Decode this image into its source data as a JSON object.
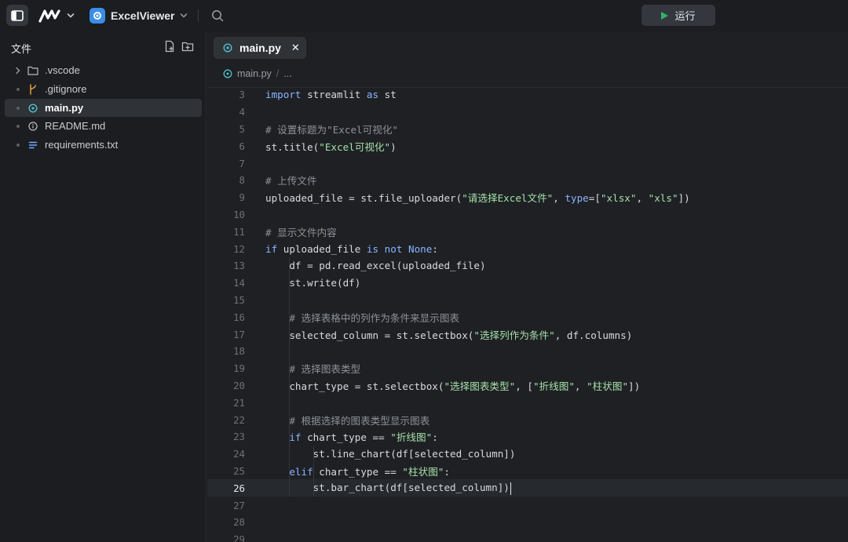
{
  "topbar": {
    "project_name": "ExcelViewer",
    "run_label": "运行"
  },
  "sidebar": {
    "title": "文件",
    "items": [
      {
        "label": ".vscode",
        "icon": "folder-icon",
        "type": "folder"
      },
      {
        "label": ".gitignore",
        "icon": "git-branch-icon",
        "type": "file"
      },
      {
        "label": "main.py",
        "icon": "python-file-icon",
        "type": "file",
        "active": true
      },
      {
        "label": "README.md",
        "icon": "info-file-icon",
        "type": "file"
      },
      {
        "label": "requirements.txt",
        "icon": "text-file-icon",
        "type": "file"
      }
    ]
  },
  "editor": {
    "tab_label": "main.py",
    "breadcrumb": [
      "main.py",
      "/",
      "..."
    ],
    "current_line": 26,
    "lines": [
      {
        "n": "3",
        "tokens": [
          [
            "kw",
            "import"
          ],
          [
            "op",
            " streamlit "
          ],
          [
            "kw",
            "as"
          ],
          [
            "op",
            " st"
          ]
        ]
      },
      {
        "n": "4",
        "tokens": []
      },
      {
        "n": "5",
        "tokens": [
          [
            "cm",
            "# 设置标题为\"Excel可视化\""
          ]
        ]
      },
      {
        "n": "6",
        "tokens": [
          [
            "op",
            "st.title("
          ],
          [
            "str",
            "\"Excel可视化\""
          ],
          [
            "op",
            ")"
          ]
        ]
      },
      {
        "n": "7",
        "tokens": []
      },
      {
        "n": "8",
        "tokens": [
          [
            "cm",
            "# 上传文件"
          ]
        ]
      },
      {
        "n": "9",
        "tokens": [
          [
            "op",
            "uploaded_file = st.file_uploader("
          ],
          [
            "str",
            "\"请选择Excel文件\""
          ],
          [
            "op",
            ", "
          ],
          [
            "kw",
            "type"
          ],
          [
            "op",
            "=["
          ],
          [
            "str",
            "\"xlsx\""
          ],
          [
            "op",
            ", "
          ],
          [
            "str",
            "\"xls\""
          ],
          [
            "op",
            "])"
          ]
        ]
      },
      {
        "n": "10",
        "tokens": []
      },
      {
        "n": "11",
        "tokens": [
          [
            "cm",
            "# 显示文件内容"
          ]
        ]
      },
      {
        "n": "12",
        "tokens": [
          [
            "kw",
            "if"
          ],
          [
            "op",
            " uploaded_file "
          ],
          [
            "kw",
            "is not"
          ],
          [
            "op",
            " "
          ],
          [
            "kw",
            "None"
          ],
          [
            "op",
            ":"
          ]
        ]
      },
      {
        "n": "13",
        "tokens": [
          [
            "op",
            "    df = pd.read_excel(uploaded_file)"
          ]
        ]
      },
      {
        "n": "14",
        "tokens": [
          [
            "op",
            "    st.write(df)"
          ]
        ]
      },
      {
        "n": "15",
        "tokens": []
      },
      {
        "n": "16",
        "tokens": [
          [
            "op",
            "    "
          ],
          [
            "cm",
            "# 选择表格中的列作为条件来显示图表"
          ]
        ]
      },
      {
        "n": "17",
        "tokens": [
          [
            "op",
            "    selected_column = st.selectbox("
          ],
          [
            "str",
            "\"选择列作为条件\""
          ],
          [
            "op",
            ", df.columns)"
          ]
        ]
      },
      {
        "n": "18",
        "tokens": []
      },
      {
        "n": "19",
        "tokens": [
          [
            "op",
            "    "
          ],
          [
            "cm",
            "# 选择图表类型"
          ]
        ]
      },
      {
        "n": "20",
        "tokens": [
          [
            "op",
            "    chart_type = st.selectbox("
          ],
          [
            "str",
            "\"选择图表类型\""
          ],
          [
            "op",
            ", ["
          ],
          [
            "str",
            "\"折线图\""
          ],
          [
            "op",
            ", "
          ],
          [
            "str",
            "\"柱状图\""
          ],
          [
            "op",
            "])"
          ]
        ]
      },
      {
        "n": "21",
        "tokens": []
      },
      {
        "n": "22",
        "tokens": [
          [
            "op",
            "    "
          ],
          [
            "cm",
            "# 根据选择的图表类型显示图表"
          ]
        ]
      },
      {
        "n": "23",
        "tokens": [
          [
            "op",
            "    "
          ],
          [
            "kw",
            "if"
          ],
          [
            "op",
            " chart_type == "
          ],
          [
            "str",
            "\"折线图\""
          ],
          [
            "op",
            ":"
          ]
        ]
      },
      {
        "n": "24",
        "tokens": [
          [
            "op",
            "        st.line_chart(df[selected_column])"
          ]
        ]
      },
      {
        "n": "25",
        "tokens": [
          [
            "op",
            "    "
          ],
          [
            "kw",
            "elif"
          ],
          [
            "op",
            " chart_type == "
          ],
          [
            "str",
            "\"柱状图\""
          ],
          [
            "op",
            ":"
          ]
        ]
      },
      {
        "n": "26",
        "tokens": [
          [
            "op",
            "        st.bar_chart(df[selected_column])"
          ]
        ]
      },
      {
        "n": "27",
        "tokens": []
      },
      {
        "n": "28",
        "tokens": []
      },
      {
        "n": "29",
        "tokens": []
      }
    ]
  },
  "colors": {
    "accent_blue": "#3a8ee6",
    "run_green": "#2fb36b",
    "keyword": "#8ab4ff",
    "string": "#a6e0a8",
    "comment": "#8d9198"
  }
}
